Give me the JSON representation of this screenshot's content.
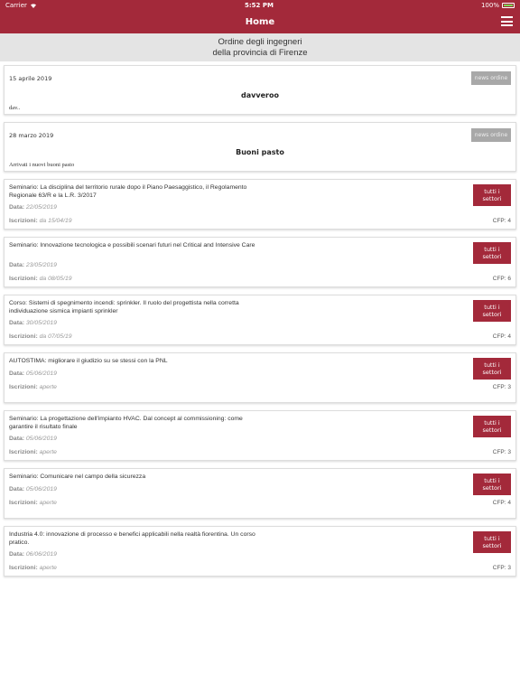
{
  "status_bar": {
    "carrier": "Carrier",
    "time": "5:52 PM",
    "battery": "100%"
  },
  "nav": {
    "title": "Home"
  },
  "subheader": {
    "line1": "Ordine degli ingegneri",
    "line2": "della provincia di Firenze"
  },
  "labels": {
    "data": "Data:",
    "iscrizioni": "Iscrizioni:"
  },
  "news": [
    {
      "date": "15 aprile 2019",
      "badge": "news ordine",
      "title": "davveroo",
      "snippet": "dav.."
    },
    {
      "date": "28 marzo 2019",
      "badge": "news ordine",
      "title": "Buoni pasto",
      "snippet": "Arrivati i nuovi buoni pasto"
    }
  ],
  "events": [
    {
      "title": "Seminario: La disciplina del territorio rurale dopo il Piano Paesaggistico, il Regolamento Regionale 63/R e la L.R. 3/2017",
      "badge": "tutti i settori",
      "data": "22/05/2019",
      "iscrizioni": "da 15/04/19",
      "cfp": "CFP: 4"
    },
    {
      "title": "Seminario: Innovazione tecnologica e possibili scenari futuri nel Critical and Intensive Care",
      "badge": "tutti i settori",
      "data": "23/05/2019",
      "iscrizioni": "da 08/05/19",
      "cfp": "CFP: 6"
    },
    {
      "title": "Corso: Sistemi di spegnimento incendi: sprinkler. Il ruolo del progettista nella corretta individuazione sismica impianti sprinkler",
      "badge": "tutti i settori",
      "data": "30/05/2019",
      "iscrizioni": "da 07/05/19",
      "cfp": "CFP: 4"
    },
    {
      "title": "AUTOSTIMA: migliorare il giudizio su se stessi con la PNL",
      "badge": "tutti i settori",
      "data": "05/06/2019",
      "iscrizioni": "aperte",
      "cfp": "CFP: 3"
    },
    {
      "title": "Seminario: La progettazione dell'impianto HVAC. Dal concept al commissioning: come garantire il risultato finale",
      "badge": "tutti i settori",
      "data": "05/06/2019",
      "iscrizioni": "aperte",
      "cfp": "CFP: 3"
    },
    {
      "title": "Seminario: Comunicare nel campo della sicurezza",
      "badge": "tutti i settori",
      "data": "05/06/2019",
      "iscrizioni": "aperte",
      "cfp": "CFP: 4"
    },
    {
      "title": "Industria 4.0: innovazione di processo e benefici applicabili nella realtà fiorentina. Un corso pratico.",
      "badge": "tutti i settori",
      "data": "06/06/2019",
      "iscrizioni": "aperte",
      "cfp": "CFP: 3"
    }
  ],
  "colors": {
    "brand": "#a3293a",
    "news_badge": "#a8a8a8",
    "battery": "#7ed957"
  },
  "icons": {
    "wifi": "wifi-icon",
    "battery": "battery-icon",
    "menu": "hamburger-menu-icon"
  }
}
